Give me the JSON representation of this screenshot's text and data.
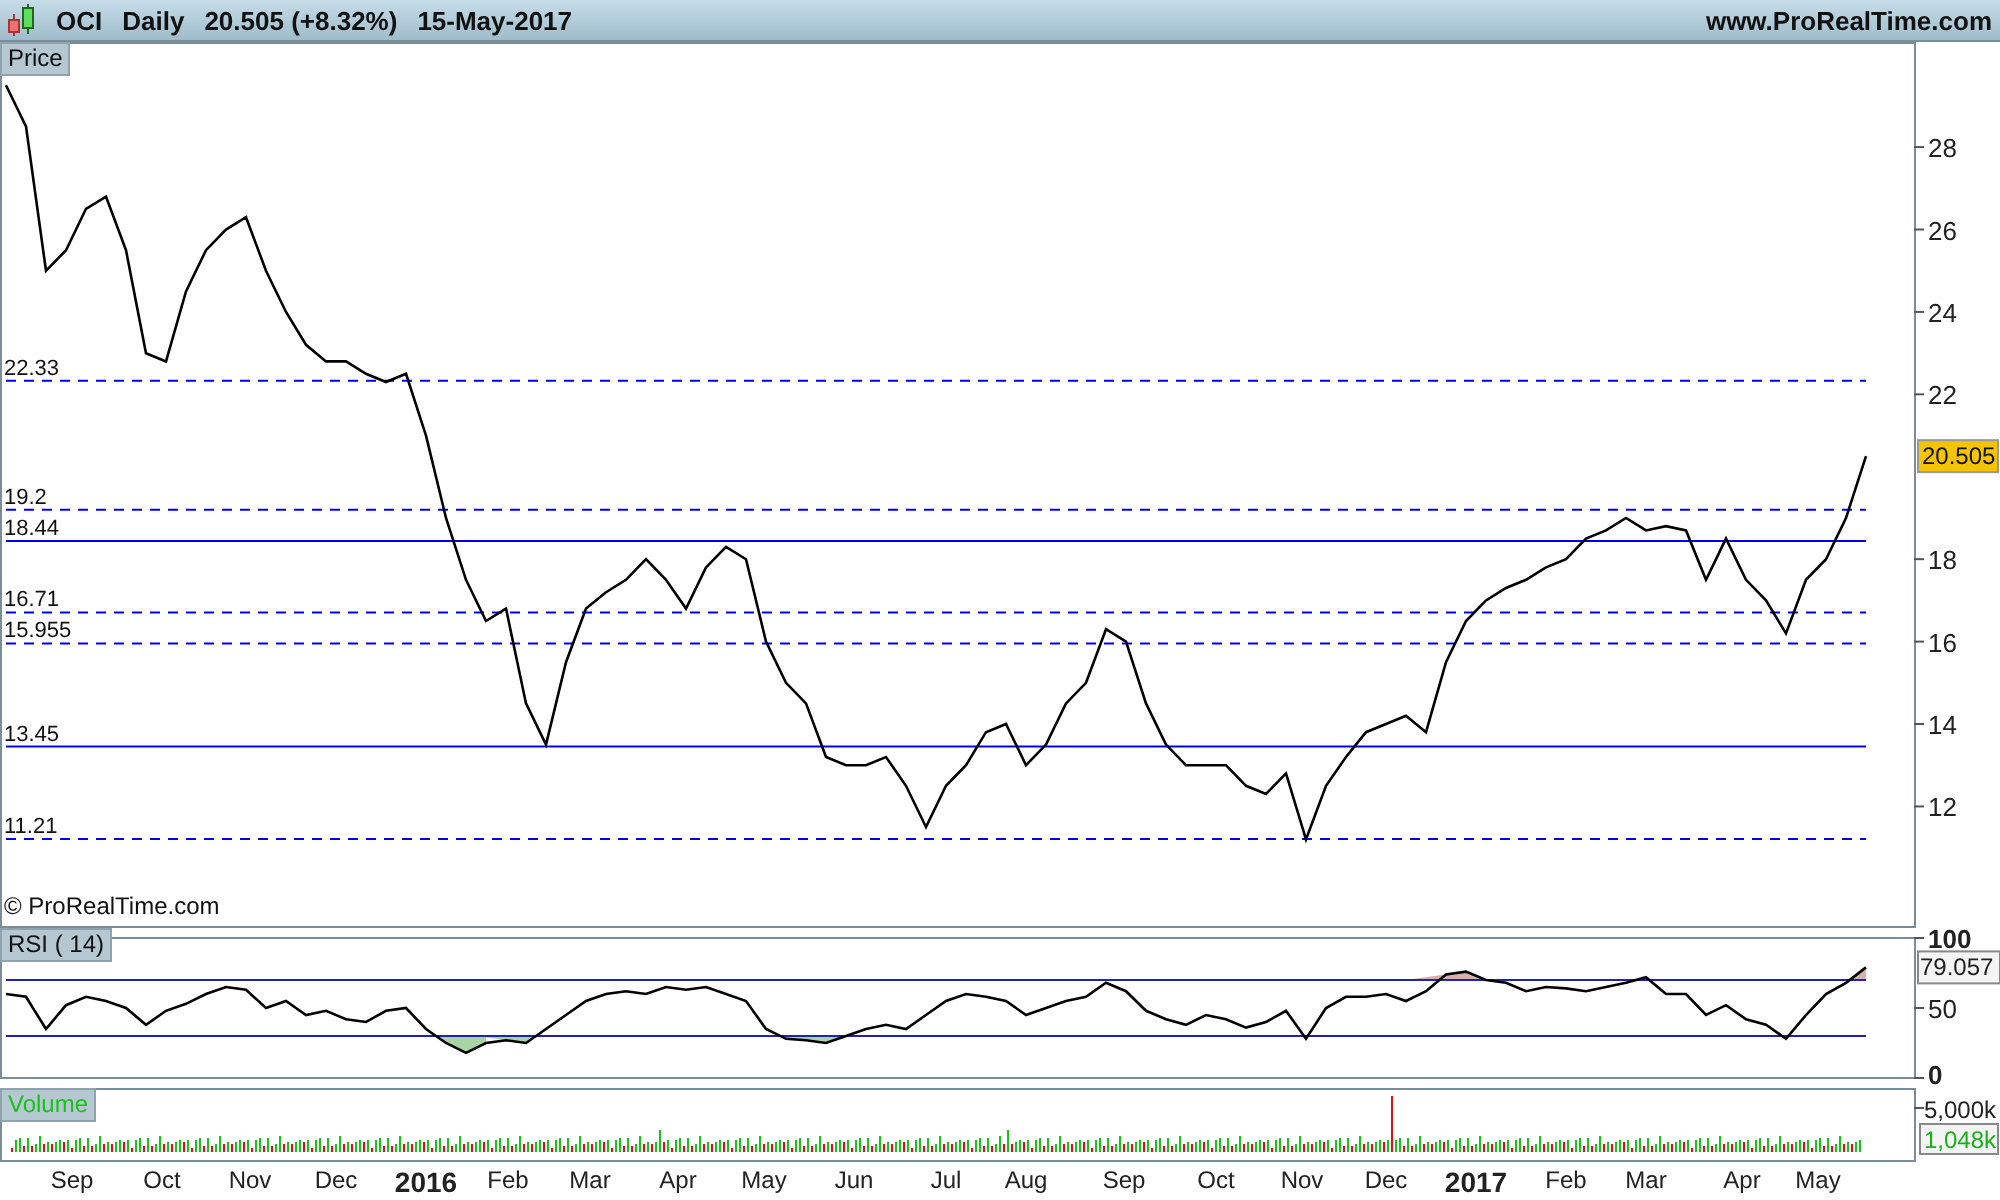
{
  "header": {
    "period": "Daily",
    "quote": "20.505 (+8.32%)",
    "date": "15-May-2017",
    "site": "www.ProRealTime.com"
  },
  "price_panel": {
    "copyright": "© ProRealTime.com",
    "last_value": "20.505",
    "chart_data": {
      "type": "line",
      "title": "Price",
      "ylim": [
        9.05,
        30.55
      ],
      "yticks": [
        12,
        14,
        16,
        18,
        22,
        24,
        26,
        28
      ],
      "series": [
        {
          "name": "OCI",
          "color": "#000000",
          "values": [
            29.5,
            28.5,
            25,
            25.5,
            26.5,
            26.8,
            25.5,
            23,
            22.8,
            24.5,
            25.5,
            26,
            26.3,
            25,
            24,
            23.2,
            22.8,
            22.8,
            22.5,
            22.3,
            22.5,
            21,
            19,
            17.5,
            16.5,
            16.8,
            14.5,
            13.5,
            15.5,
            16.8,
            17.2,
            17.5,
            18,
            17.5,
            16.8,
            17.8,
            18.3,
            18,
            16,
            15,
            14.5,
            13.2,
            13,
            13,
            13.2,
            12.5,
            11.5,
            12.5,
            13,
            13.8,
            14,
            13,
            13.5,
            14.5,
            15,
            16.3,
            16,
            14.5,
            13.5,
            13,
            13,
            13,
            12.5,
            12.3,
            12.8,
            11.2,
            12.5,
            13.2,
            13.8,
            14,
            14.2,
            13.8,
            15.5,
            16.5,
            17,
            17.3,
            17.5,
            17.8,
            18,
            18.5,
            18.7,
            19,
            18.7,
            18.8,
            18.7,
            17.5,
            18.5,
            17.5,
            17,
            16.2,
            17.5,
            18,
            19,
            20.5
          ]
        },
        {
          "name": "22.33",
          "color": "#0000ee",
          "line_style": "dashed",
          "values": [
            22.33,
            22.33,
            22.33,
            22.33,
            22.33,
            22.33,
            22.33,
            22.33,
            22.33,
            22.33,
            22.33,
            22.33,
            22.33,
            22.33,
            22.33,
            22.33,
            22.33,
            22.33,
            22.33,
            22.33,
            22.33,
            22.33,
            22.33,
            22.33,
            22.33,
            22.33,
            22.33,
            22.33,
            22.33,
            22.33,
            22.33,
            22.33,
            22.33,
            22.33,
            22.33,
            22.33,
            22.33,
            22.33,
            22.33,
            22.33,
            22.33,
            22.33,
            22.33,
            22.33,
            22.33,
            22.33,
            22.33,
            22.33,
            22.33,
            22.33,
            22.33,
            22.33,
            22.33,
            22.33,
            22.33,
            22.33,
            22.33,
            22.33,
            22.33,
            22.33,
            22.33,
            22.33,
            22.33,
            22.33,
            22.33,
            22.33,
            22.33,
            22.33,
            22.33,
            22.33,
            22.33,
            22.33,
            22.33,
            22.33,
            22.33,
            22.33,
            22.33,
            22.33,
            22.33,
            22.33,
            22.33,
            22.33,
            22.33,
            22.33,
            22.33,
            22.33,
            22.33,
            22.33,
            22.33,
            22.33,
            22.33,
            22.33,
            22.33,
            22.33
          ]
        },
        {
          "name": "19.2",
          "color": "#0000ee",
          "line_style": "dashed",
          "values": [
            19.2,
            19.2,
            19.2,
            19.2,
            19.2,
            19.2,
            19.2,
            19.2,
            19.2,
            19.2,
            19.2,
            19.2,
            19.2,
            19.2,
            19.2,
            19.2,
            19.2,
            19.2,
            19.2,
            19.2,
            19.2,
            19.2,
            19.2,
            19.2,
            19.2,
            19.2,
            19.2,
            19.2,
            19.2,
            19.2,
            19.2,
            19.2,
            19.2,
            19.2,
            19.2,
            19.2,
            19.2,
            19.2,
            19.2,
            19.2,
            19.2,
            19.2,
            19.2,
            19.2,
            19.2,
            19.2,
            19.2,
            19.2,
            19.2,
            19.2,
            19.2,
            19.2,
            19.2,
            19.2,
            19.2,
            19.2,
            19.2,
            19.2,
            19.2,
            19.2,
            19.2,
            19.2,
            19.2,
            19.2,
            19.2,
            19.2,
            19.2,
            19.2,
            19.2,
            19.2,
            19.2,
            19.2,
            19.2,
            19.2,
            19.2,
            19.2,
            19.2,
            19.2,
            19.2,
            19.2,
            19.2,
            19.2,
            19.2,
            19.2,
            19.2,
            19.2,
            19.2,
            19.2,
            19.2,
            19.2,
            19.2,
            19.2,
            19.2,
            19.2
          ]
        },
        {
          "name": "18.44",
          "color": "#0000ee",
          "line_style": "solid",
          "values": [
            18.44,
            18.44,
            18.44,
            18.44,
            18.44,
            18.44,
            18.44,
            18.44,
            18.44,
            18.44,
            18.44,
            18.44,
            18.44,
            18.44,
            18.44,
            18.44,
            18.44,
            18.44,
            18.44,
            18.44,
            18.44,
            18.44,
            18.44,
            18.44,
            18.44,
            18.44,
            18.44,
            18.44,
            18.44,
            18.44,
            18.44,
            18.44,
            18.44,
            18.44,
            18.44,
            18.44,
            18.44,
            18.44,
            18.44,
            18.44,
            18.44,
            18.44,
            18.44,
            18.44,
            18.44,
            18.44,
            18.44,
            18.44,
            18.44,
            18.44,
            18.44,
            18.44,
            18.44,
            18.44,
            18.44,
            18.44,
            18.44,
            18.44,
            18.44,
            18.44,
            18.44,
            18.44,
            18.44,
            18.44,
            18.44,
            18.44,
            18.44,
            18.44,
            18.44,
            18.44,
            18.44,
            18.44,
            18.44,
            18.44,
            18.44,
            18.44,
            18.44,
            18.44,
            18.44,
            18.44,
            18.44,
            18.44,
            18.44,
            18.44,
            18.44,
            18.44,
            18.44,
            18.44,
            18.44,
            18.44,
            18.44,
            18.44,
            18.44,
            18.44
          ]
        },
        {
          "name": "16.71",
          "color": "#0000ee",
          "line_style": "dashed",
          "values": [
            16.71,
            16.71,
            16.71,
            16.71,
            16.71,
            16.71,
            16.71,
            16.71,
            16.71,
            16.71,
            16.71,
            16.71,
            16.71,
            16.71,
            16.71,
            16.71,
            16.71,
            16.71,
            16.71,
            16.71,
            16.71,
            16.71,
            16.71,
            16.71,
            16.71,
            16.71,
            16.71,
            16.71,
            16.71,
            16.71,
            16.71,
            16.71,
            16.71,
            16.71,
            16.71,
            16.71,
            16.71,
            16.71,
            16.71,
            16.71,
            16.71,
            16.71,
            16.71,
            16.71,
            16.71,
            16.71,
            16.71,
            16.71,
            16.71,
            16.71,
            16.71,
            16.71,
            16.71,
            16.71,
            16.71,
            16.71,
            16.71,
            16.71,
            16.71,
            16.71,
            16.71,
            16.71,
            16.71,
            16.71,
            16.71,
            16.71,
            16.71,
            16.71,
            16.71,
            16.71,
            16.71,
            16.71,
            16.71,
            16.71,
            16.71,
            16.71,
            16.71,
            16.71,
            16.71,
            16.71,
            16.71,
            16.71,
            16.71,
            16.71,
            16.71,
            16.71,
            16.71,
            16.71,
            16.71,
            16.71,
            16.71,
            16.71,
            16.71,
            16.71
          ]
        },
        {
          "name": "15.955",
          "color": "#0000ee",
          "line_style": "dashed",
          "values": [
            15.955,
            15.955,
            15.955,
            15.955,
            15.955,
            15.955,
            15.955,
            15.955,
            15.955,
            15.955,
            15.955,
            15.955,
            15.955,
            15.955,
            15.955,
            15.955,
            15.955,
            15.955,
            15.955,
            15.955,
            15.955,
            15.955,
            15.955,
            15.955,
            15.955,
            15.955,
            15.955,
            15.955,
            15.955,
            15.955,
            15.955,
            15.955,
            15.955,
            15.955,
            15.955,
            15.955,
            15.955,
            15.955,
            15.955,
            15.955,
            15.955,
            15.955,
            15.955,
            15.955,
            15.955,
            15.955,
            15.955,
            15.955,
            15.955,
            15.955,
            15.955,
            15.955,
            15.955,
            15.955,
            15.955,
            15.955,
            15.955,
            15.955,
            15.955,
            15.955,
            15.955,
            15.955,
            15.955,
            15.955,
            15.955,
            15.955,
            15.955,
            15.955,
            15.955,
            15.955,
            15.955,
            15.955,
            15.955,
            15.955,
            15.955,
            15.955,
            15.955,
            15.955,
            15.955,
            15.955,
            15.955,
            15.955,
            15.955,
            15.955,
            15.955,
            15.955,
            15.955,
            15.955,
            15.955,
            15.955,
            15.955,
            15.955,
            15.955,
            15.955
          ]
        },
        {
          "name": "13.45",
          "color": "#0000ee",
          "line_style": "solid",
          "values": [
            13.45,
            13.45,
            13.45,
            13.45,
            13.45,
            13.45,
            13.45,
            13.45,
            13.45,
            13.45,
            13.45,
            13.45,
            13.45,
            13.45,
            13.45,
            13.45,
            13.45,
            13.45,
            13.45,
            13.45,
            13.45,
            13.45,
            13.45,
            13.45,
            13.45,
            13.45,
            13.45,
            13.45,
            13.45,
            13.45,
            13.45,
            13.45,
            13.45,
            13.45,
            13.45,
            13.45,
            13.45,
            13.45,
            13.45,
            13.45,
            13.45,
            13.45,
            13.45,
            13.45,
            13.45,
            13.45,
            13.45,
            13.45,
            13.45,
            13.45,
            13.45,
            13.45,
            13.45,
            13.45,
            13.45,
            13.45,
            13.45,
            13.45,
            13.45,
            13.45,
            13.45,
            13.45,
            13.45,
            13.45,
            13.45,
            13.45,
            13.45,
            13.45,
            13.45,
            13.45,
            13.45,
            13.45,
            13.45,
            13.45,
            13.45,
            13.45,
            13.45,
            13.45,
            13.45,
            13.45,
            13.45,
            13.45,
            13.45,
            13.45,
            13.45,
            13.45,
            13.45,
            13.45,
            13.45,
            13.45,
            13.45,
            13.45,
            13.45,
            13.45
          ]
        },
        {
          "name": "11.21",
          "color": "#0000ee",
          "line_style": "dashed",
          "values": [
            11.21,
            11.21,
            11.21,
            11.21,
            11.21,
            11.21,
            11.21,
            11.21,
            11.21,
            11.21,
            11.21,
            11.21,
            11.21,
            11.21,
            11.21,
            11.21,
            11.21,
            11.21,
            11.21,
            11.21,
            11.21,
            11.21,
            11.21,
            11.21,
            11.21,
            11.21,
            11.21,
            11.21,
            11.21,
            11.21,
            11.21,
            11.21,
            11.21,
            11.21,
            11.21,
            11.21,
            11.21,
            11.21,
            11.21,
            11.21,
            11.21,
            11.21,
            11.21,
            11.21,
            11.21,
            11.21,
            11.21,
            11.21,
            11.21,
            11.21,
            11.21,
            11.21,
            11.21,
            11.21,
            11.21,
            11.21,
            11.21,
            11.21,
            11.21,
            11.21,
            11.21,
            11.21,
            11.21,
            11.21,
            11.21,
            11.21,
            11.21,
            11.21,
            11.21,
            11.21,
            11.21,
            11.21,
            11.21,
            11.21,
            11.21,
            11.21,
            11.21,
            11.21,
            11.21,
            11.21,
            11.21,
            11.21,
            11.21,
            11.21,
            11.21,
            11.21,
            11.21,
            11.21,
            11.21,
            11.21,
            11.21,
            11.21,
            11.21,
            11.21
          ]
        }
      ]
    }
  },
  "rsi_panel": {
    "last_value": "79.057",
    "chart_data": {
      "type": "line",
      "title": "RSI ( 14)",
      "ylim": [
        0,
        100
      ],
      "yticks": [
        0,
        50,
        100
      ],
      "series": [
        {
          "color": "#000000",
          "values": [
            60,
            58,
            35,
            52,
            58,
            55,
            50,
            38,
            48,
            53,
            60,
            65,
            63,
            50,
            55,
            45,
            48,
            42,
            40,
            48,
            50,
            35,
            25,
            18,
            25,
            27,
            25,
            35,
            45,
            55,
            60,
            62,
            60,
            65,
            63,
            65,
            60,
            55,
            35,
            28,
            27,
            25,
            30,
            35,
            38,
            35,
            45,
            55,
            60,
            58,
            55,
            45,
            50,
            55,
            58,
            68,
            62,
            48,
            42,
            38,
            45,
            42,
            36,
            40,
            48,
            28,
            50,
            58,
            58,
            60,
            55,
            62,
            74,
            76,
            70,
            68,
            62,
            65,
            64,
            62,
            65,
            68,
            72,
            60,
            60,
            45,
            52,
            42,
            38,
            28,
            45,
            60,
            68,
            79
          ]
        },
        {
          "color": "#2222aa",
          "values": [
            70,
            70,
            70,
            70,
            70,
            70,
            70,
            70,
            70,
            70,
            70,
            70,
            70,
            70,
            70,
            70,
            70,
            70,
            70,
            70,
            70,
            70,
            70,
            70,
            70,
            70,
            70,
            70,
            70,
            70,
            70,
            70,
            70,
            70,
            70,
            70,
            70,
            70,
            70,
            70,
            70,
            70,
            70,
            70,
            70,
            70,
            70,
            70,
            70,
            70,
            70,
            70,
            70,
            70,
            70,
            70,
            70,
            70,
            70,
            70,
            70,
            70,
            70,
            70,
            70,
            70,
            70,
            70,
            70,
            70,
            70,
            70,
            70,
            70,
            70,
            70,
            70,
            70,
            70,
            70,
            70,
            70,
            70,
            70,
            70,
            70,
            70,
            70,
            70,
            70,
            70,
            70,
            70,
            70
          ]
        },
        {
          "color": "#2222aa",
          "values": [
            30,
            30,
            30,
            30,
            30,
            30,
            30,
            30,
            30,
            30,
            30,
            30,
            30,
            30,
            30,
            30,
            30,
            30,
            30,
            30,
            30,
            30,
            30,
            30,
            30,
            30,
            30,
            30,
            30,
            30,
            30,
            30,
            30,
            30,
            30,
            30,
            30,
            30,
            30,
            30,
            30,
            30,
            30,
            30,
            30,
            30,
            30,
            30,
            30,
            30,
            30,
            30,
            30,
            30,
            30,
            30,
            30,
            30,
            30,
            30,
            30,
            30,
            30,
            30,
            30,
            30,
            30,
            30,
            30,
            30,
            30,
            30,
            30,
            30,
            30,
            30,
            30,
            30,
            30,
            30,
            30,
            30,
            30,
            30,
            30,
            30,
            30,
            30,
            30,
            30,
            30,
            30,
            30,
            30
          ]
        }
      ]
    }
  },
  "volume_panel": {
    "label": "Volume",
    "tick": "5,000k",
    "last_value": "1,048k"
  },
  "time_axis": [
    {
      "label": "Sep",
      "year": false
    },
    {
      "label": "Oct",
      "year": false
    },
    {
      "label": "Nov",
      "year": false
    },
    {
      "label": "Dec",
      "year": false
    },
    {
      "label": "2016",
      "year": true
    },
    {
      "label": "Feb",
      "year": false
    },
    {
      "label": "Mar",
      "year": false
    },
    {
      "label": "Apr",
      "year": false
    },
    {
      "label": "May",
      "year": false
    },
    {
      "label": "Jun",
      "year": false
    },
    {
      "label": "Jul",
      "year": false
    },
    {
      "label": "Aug",
      "year": false
    },
    {
      "label": "Sep",
      "year": false
    },
    {
      "label": "Oct",
      "year": false
    },
    {
      "label": "Nov",
      "year": false
    },
    {
      "label": "Dec",
      "year": false
    },
    {
      "label": "2017",
      "year": true
    },
    {
      "label": "Feb",
      "year": false
    },
    {
      "label": "Mar",
      "year": false
    },
    {
      "label": "Apr",
      "year": false
    },
    {
      "label": "May",
      "year": false
    }
  ]
}
